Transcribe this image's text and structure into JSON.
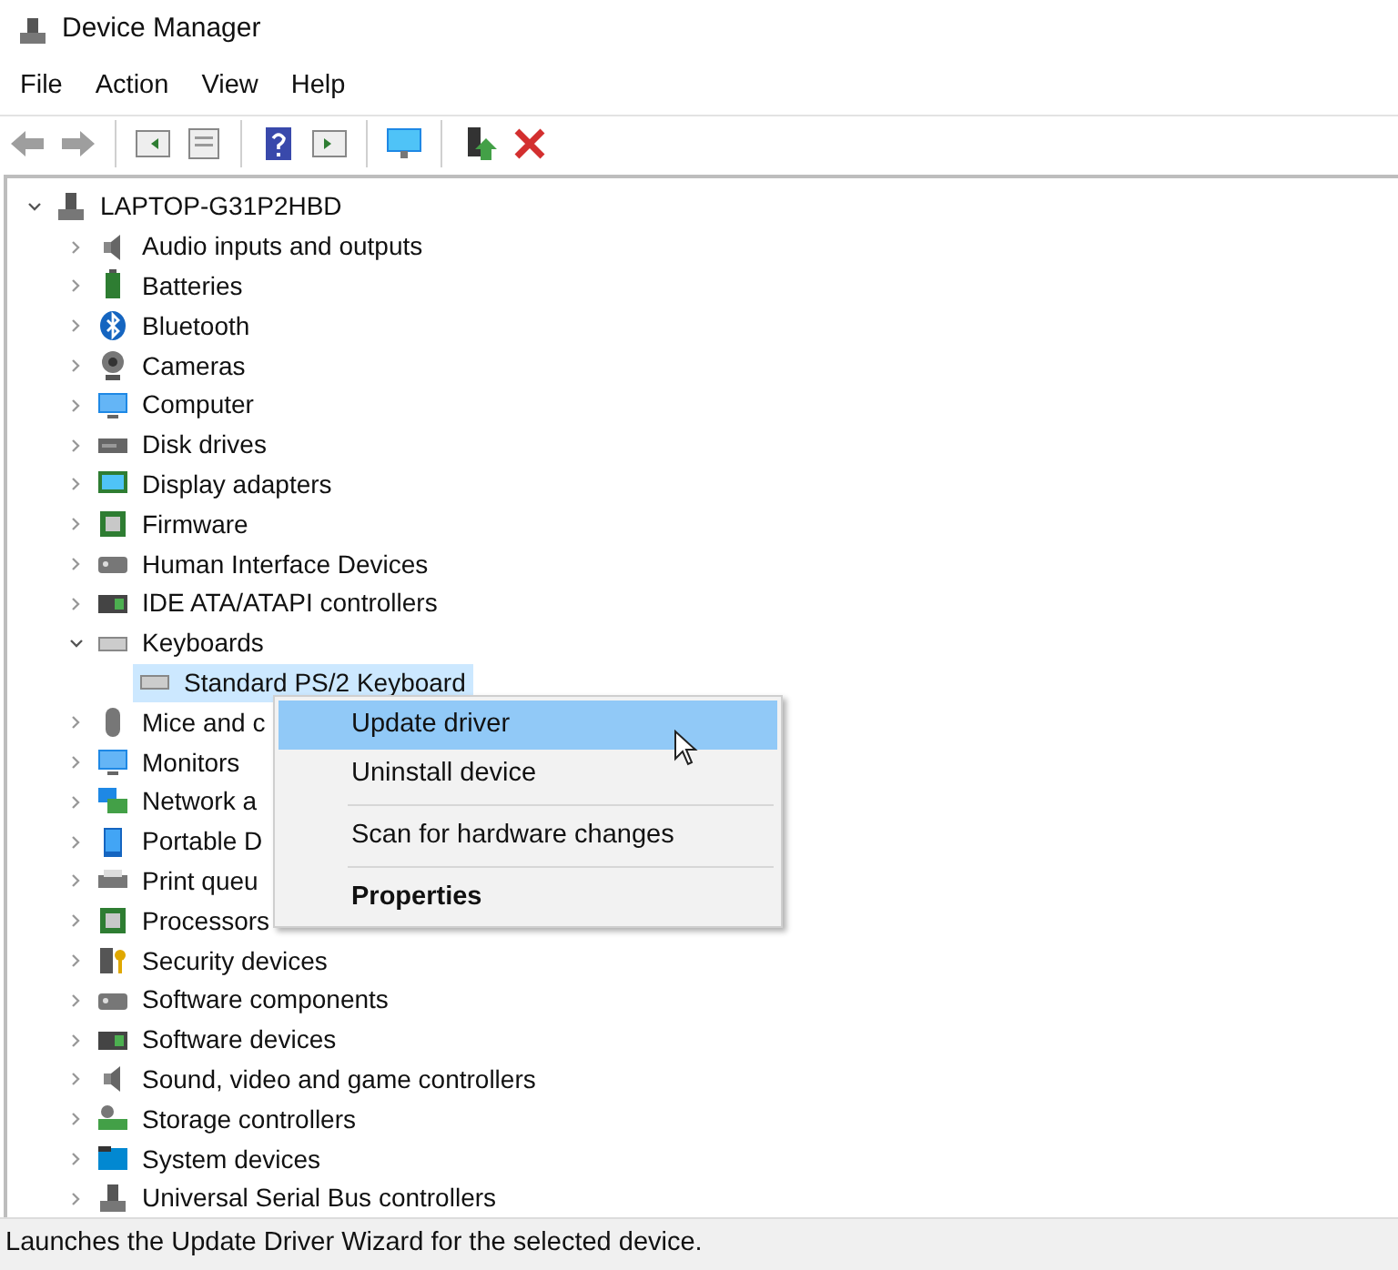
{
  "window": {
    "title": "Device Manager"
  },
  "menu_bar": [
    "File",
    "Action",
    "View",
    "Help"
  ],
  "toolbar": [
    {
      "kind": "back"
    },
    {
      "kind": "forward"
    },
    {
      "kind": "sep"
    },
    {
      "kind": "panel-left"
    },
    {
      "kind": "sheet"
    },
    {
      "kind": "sep"
    },
    {
      "kind": "help"
    },
    {
      "kind": "panel-right"
    },
    {
      "kind": "sep"
    },
    {
      "kind": "monitor"
    },
    {
      "kind": "sep"
    },
    {
      "kind": "add-driver"
    },
    {
      "kind": "remove"
    }
  ],
  "tree": [
    {
      "label": "LAPTOP-G31P2HBD",
      "kind": "computer-tower",
      "expanded": true,
      "selected": false,
      "children": [
        {
          "label": "Audio inputs and outputs",
          "kind": "speaker",
          "expanded": false,
          "selected": false
        },
        {
          "label": "Batteries",
          "kind": "battery",
          "expanded": false,
          "selected": false
        },
        {
          "label": "Bluetooth",
          "kind": "bluetooth",
          "expanded": false,
          "selected": false
        },
        {
          "label": "Cameras",
          "kind": "camera",
          "expanded": false,
          "selected": false
        },
        {
          "label": "Computer",
          "kind": "monitor",
          "expanded": false,
          "selected": false
        },
        {
          "label": "Disk drives",
          "kind": "disk",
          "expanded": false,
          "selected": false
        },
        {
          "label": "Display adapters",
          "kind": "display",
          "expanded": false,
          "selected": false
        },
        {
          "label": "Firmware",
          "kind": "chip",
          "expanded": false,
          "selected": false
        },
        {
          "label": "Human Interface Devices",
          "kind": "hid",
          "expanded": false,
          "selected": false
        },
        {
          "label": "IDE ATA/ATAPI controllers",
          "kind": "board",
          "expanded": false,
          "selected": false
        },
        {
          "label": "Keyboards",
          "kind": "keyboard",
          "expanded": true,
          "selected": false,
          "children": [
            {
              "label": "Standard PS/2 Keyboard",
              "kind": "keyboard",
              "selected": true
            }
          ]
        },
        {
          "label": "Mice and c",
          "kind": "mouse",
          "expanded": false,
          "selected": false
        },
        {
          "label": "Monitors",
          "kind": "monitor",
          "expanded": false,
          "selected": false
        },
        {
          "label": "Network a",
          "kind": "network",
          "expanded": false,
          "selected": false
        },
        {
          "label": "Portable D",
          "kind": "tablet",
          "expanded": false,
          "selected": false
        },
        {
          "label": "Print queu",
          "kind": "printer",
          "expanded": false,
          "selected": false
        },
        {
          "label": "Processors",
          "kind": "chip",
          "expanded": false,
          "selected": false
        },
        {
          "label": "Security devices",
          "kind": "key",
          "expanded": false,
          "selected": false
        },
        {
          "label": "Software components",
          "kind": "hid",
          "expanded": false,
          "selected": false
        },
        {
          "label": "Software devices",
          "kind": "board",
          "expanded": false,
          "selected": false
        },
        {
          "label": "Sound, video and game controllers",
          "kind": "speaker",
          "expanded": false,
          "selected": false
        },
        {
          "label": "Storage controllers",
          "kind": "storage",
          "expanded": false,
          "selected": false
        },
        {
          "label": "System devices",
          "kind": "folder",
          "expanded": false,
          "selected": false
        },
        {
          "label": "Universal Serial Bus controllers",
          "kind": "computer-tower",
          "expanded": false,
          "selected": false
        }
      ]
    }
  ],
  "context_menu": [
    {
      "kind": "item",
      "label": "Update driver",
      "selected": true,
      "bold": false
    },
    {
      "kind": "item",
      "label": "Uninstall device",
      "selected": false,
      "bold": false
    },
    {
      "kind": "separator"
    },
    {
      "kind": "item",
      "label": "Scan for hardware changes",
      "selected": false,
      "bold": false
    },
    {
      "kind": "separator"
    },
    {
      "kind": "item",
      "label": "Properties",
      "selected": false,
      "bold": true
    }
  ],
  "status_bar": "Launches the Update Driver Wizard for the selected device."
}
